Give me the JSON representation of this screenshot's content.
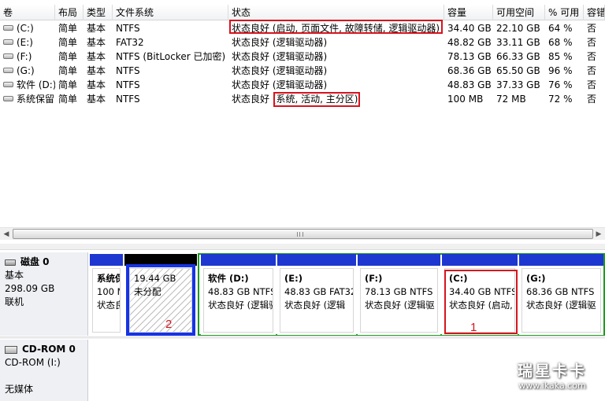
{
  "columns": [
    "卷",
    "布局",
    "类型",
    "文件系统",
    "状态",
    "容量",
    "可用空间",
    "% 可用",
    "容错"
  ],
  "volumes": [
    {
      "name": "(C:)",
      "layout": "简单",
      "type": "基本",
      "fs": "NTFS",
      "status": "状态良好 (启动, 页面文件, 故障转储, 逻辑驱动器)",
      "capacity": "34.40 GB",
      "free": "22.10 GB",
      "pct": "64 %",
      "ft": "否"
    },
    {
      "name": "(E:)",
      "layout": "简单",
      "type": "基本",
      "fs": "FAT32",
      "status": "状态良好 (逻辑驱动器)",
      "capacity": "48.82 GB",
      "free": "33.11 GB",
      "pct": "68 %",
      "ft": "否"
    },
    {
      "name": "(F:)",
      "layout": "简单",
      "type": "基本",
      "fs": "NTFS (BitLocker 已加密)",
      "status": "状态良好 (逻辑驱动器)",
      "capacity": "78.13 GB",
      "free": "66.33 GB",
      "pct": "85 %",
      "ft": "否"
    },
    {
      "name": "(G:)",
      "layout": "简单",
      "type": "基本",
      "fs": "NTFS",
      "status": "状态良好 (逻辑驱动器)",
      "capacity": "68.36 GB",
      "free": "65.50 GB",
      "pct": "96 %",
      "ft": "否"
    },
    {
      "name": "软件 (D:)",
      "layout": "简单",
      "type": "基本",
      "fs": "NTFS",
      "status": "状态良好 (逻辑驱动器)",
      "capacity": "48.83 GB",
      "free": "37.33 GB",
      "pct": "76 %",
      "ft": "否"
    },
    {
      "name": "系统保留",
      "layout": "简单",
      "type": "基本",
      "fs": "NTFS",
      "status_prefix": "状态良好",
      "status_detail": "(系统, 活动, 主分区)",
      "capacity": "100 MB",
      "free": "72 MB",
      "pct": "72 %",
      "ft": "否"
    }
  ],
  "disk0": {
    "name": "磁盘 0",
    "type": "基本",
    "size": "298.09 GB",
    "state": "联机",
    "partitions": [
      {
        "name": "系统保",
        "size": "100 M",
        "status": "状态良"
      },
      {
        "name": "",
        "size": "19.44 GB",
        "status": "未分配"
      },
      {
        "name": "软件 (D:)",
        "size": "48.83 GB NTFS",
        "status": "状态良好 (逻辑驱"
      },
      {
        "name": "(E:)",
        "size": "48.83 GB FAT32",
        "status": "状态良好 (逻辑"
      },
      {
        "name": "(F:)",
        "size": "78.13 GB NTFS",
        "status": "状态良好 (逻辑驱"
      },
      {
        "name": "(C:)",
        "size": "34.40 GB NTFS",
        "status": "状态良好 (启动,"
      },
      {
        "name": "(G:)",
        "size": "68.36 GB NTFS",
        "status": "状态良好 (逻辑驱"
      }
    ]
  },
  "cdrom0": {
    "name": "CD-ROM 0",
    "type": "CD-ROM (I:)",
    "state": "无媒体"
  },
  "annotations": {
    "one": "1",
    "two": "2"
  },
  "watermark": {
    "line1": "瑞星卡卡",
    "line2": "www.ikaka.com"
  },
  "colors": {
    "primary_bar": "#1d37d0",
    "logical_bar": "#1d37d0",
    "extended_border": "#1e9a1e",
    "unallocated_bar": "#000000",
    "highlight": "#d6141d",
    "selection_border": "#1633e6"
  }
}
